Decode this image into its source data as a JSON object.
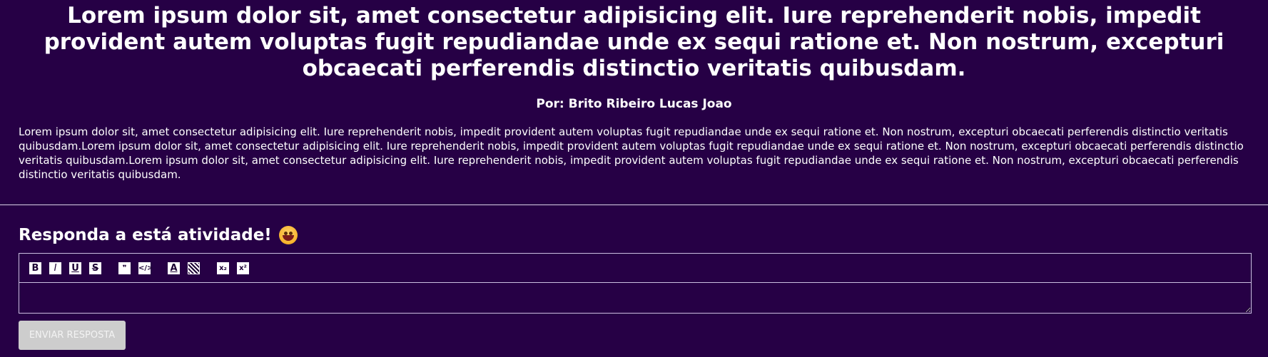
{
  "header": {
    "title": "Lorem ipsum dolor sit, amet consectetur adipisicing elit. Iure reprehenderit nobis, impedit provident autem voluptas fugit repudiandae unde ex sequi ratione et. Non nostrum, excepturi obcaecati perferendis distinctio veritatis quibusdam.",
    "author": "Por: Brito Ribeiro Lucas Joao"
  },
  "content": {
    "body": "Lorem ipsum dolor sit, amet consectetur adipisicing elit. Iure reprehenderit nobis, impedit provident autem voluptas fugit repudiandae unde ex sequi ratione et. Non nostrum, excepturi obcaecati perferendis distinctio veritatis quibusdam.Lorem ipsum dolor sit, amet consectetur adipisicing elit. Iure reprehenderit nobis, impedit provident autem voluptas fugit repudiandae unde ex sequi ratione et. Non nostrum, excepturi obcaecati perferendis distinctio veritatis quibusdam.Lorem ipsum dolor sit, amet consectetur adipisicing elit. Iure reprehenderit nobis, impedit provident autem voluptas fugit repudiandae unde ex sequi ratione et. Non nostrum, excepturi obcaecati perferendis distinctio veritatis quibusdam."
  },
  "activity": {
    "title": "Responda a está atividade!",
    "emoji": "grinning-face-icon",
    "toolbar": {
      "bold": "B",
      "italic": "I",
      "underline": "U",
      "strike": "S",
      "quote": "❞",
      "code": "</>",
      "text_color": "A",
      "background_color": "",
      "subscript": "x₂",
      "superscript": "x²"
    },
    "answer_value": "",
    "submit_label": "ENVIAR RESPOSTA"
  },
  "colors": {
    "background": "#260045",
    "text": "#ffffff",
    "divider": "#d9d2e6",
    "button_background": "#cdcdcd"
  }
}
